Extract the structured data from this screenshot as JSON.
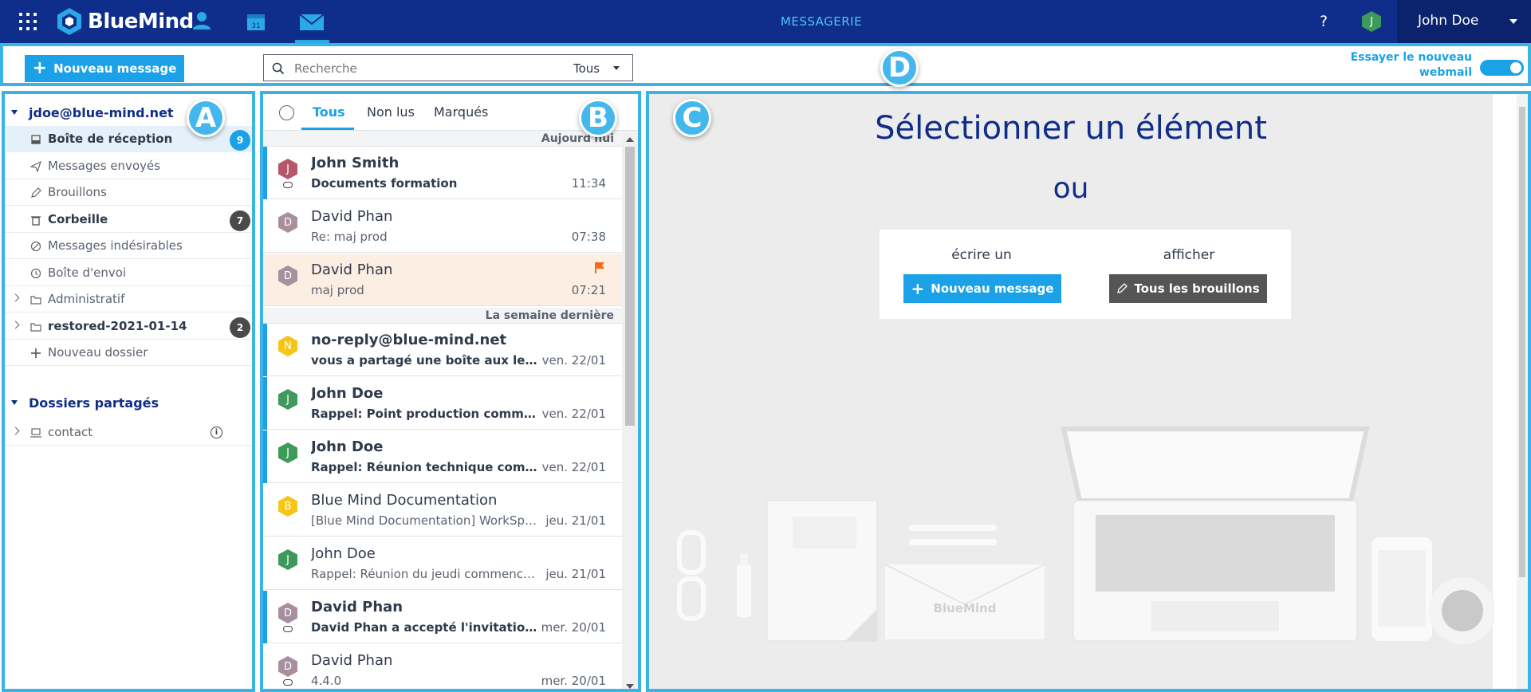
{
  "topbar": {
    "brand": "BlueMind",
    "app_title": "MESSAGERIE",
    "help": "?",
    "user_initial": "J",
    "user_name": "John Doe"
  },
  "toolbar": {
    "new_message": "Nouveau message",
    "search_placeholder": "Recherche",
    "search_scope": "Tous",
    "try_new_line1": "Essayer le nouveau",
    "try_new_line2": "webmail",
    "toggle_on": true
  },
  "markers": [
    "A",
    "B",
    "C",
    "D"
  ],
  "folders": {
    "account": "jdoe@blue-mind.net",
    "items": [
      {
        "label": "Boîte de réception",
        "badge": "9",
        "bold": true
      },
      {
        "label": "Messages envoyés",
        "badge": ""
      },
      {
        "label": "Brouillons",
        "badge": ""
      },
      {
        "label": "Corbeille",
        "badge": "7",
        "bold": true
      },
      {
        "label": "Messages indésirables",
        "badge": ""
      },
      {
        "label": "Boîte d'envoi",
        "badge": ""
      },
      {
        "label": "Administratif",
        "badge": ""
      },
      {
        "label": "restored-2021-01-14",
        "badge": "2",
        "bold": true
      },
      {
        "label": "Nouveau dossier",
        "badge": ""
      }
    ],
    "shared_title": "Dossiers partagés",
    "shared_items": [
      {
        "label": "contact"
      }
    ]
  },
  "messages": {
    "filters": [
      "Tous",
      "Non lus",
      "Marqués"
    ],
    "groups": [
      "Aujourd'hui",
      "La semaine dernière"
    ],
    "items": [
      {
        "initial": "J",
        "color": "#b5566d",
        "from": "John Smith",
        "subject": "Documents formation",
        "time": "11:34",
        "unread": true,
        "attach": true
      },
      {
        "initial": "D",
        "color": "#a78f9e",
        "from": "David Phan",
        "subject": "Re: maj prod",
        "time": "07:38",
        "unread": false
      },
      {
        "initial": "D",
        "color": "#a78f9e",
        "from": "David Phan",
        "subject": "maj prod",
        "time": "07:21",
        "unread": false,
        "flagged": true
      },
      {
        "initial": "N",
        "color": "#f5c518",
        "from": "no-reply@blue-mind.net",
        "subject": "vous a partagé une boîte aux lettres ...",
        "time": "ven. 22/01",
        "unread": true
      },
      {
        "initial": "J",
        "color": "#3d9a5b",
        "from": "John Doe",
        "subject": "Rappel: Point production commenc...",
        "time": "ven. 22/01",
        "unread": true
      },
      {
        "initial": "J",
        "color": "#3d9a5b",
        "from": "John Doe",
        "subject": "Rappel: Réunion technique commen...",
        "time": "ven. 22/01",
        "unread": true
      },
      {
        "initial": "B",
        "color": "#f5c518",
        "from": "Blue Mind Documentation",
        "subject": "[Blue Mind Documentation] WorkSpac...",
        "time": "jeu. 21/01",
        "unread": false
      },
      {
        "initial": "J",
        "color": "#3d9a5b",
        "from": "John Doe",
        "subject": "Rappel: Réunion du jeudi commence ...",
        "time": "jeu. 21/01",
        "unread": false
      },
      {
        "initial": "D",
        "color": "#a78f9e",
        "from": "David Phan",
        "subject": "David Phan a accepté l'invitation: In...",
        "time": "mer. 20/01",
        "unread": true,
        "attach": true
      },
      {
        "initial": "D",
        "color": "#a78f9e",
        "from": "David Phan",
        "subject": "4.4.0",
        "time": "mer. 20/01",
        "unread": false,
        "attach": true
      }
    ]
  },
  "empty_state": {
    "title": "Sélectionner un élément",
    "or": "ou",
    "write_label": "écrire un",
    "write_button": "Nouveau message",
    "show_label": "afficher",
    "show_button": "Tous les brouillons",
    "illustration_brand": "BlueMind"
  },
  "colors": {
    "topbar": "#0f2d8a",
    "accent": "#1aa1e8",
    "marker": "#44b7ec",
    "badge_blue": "#1aa1e8",
    "badge_dark": "#4a4a4a",
    "flag": "#f26a1b"
  }
}
